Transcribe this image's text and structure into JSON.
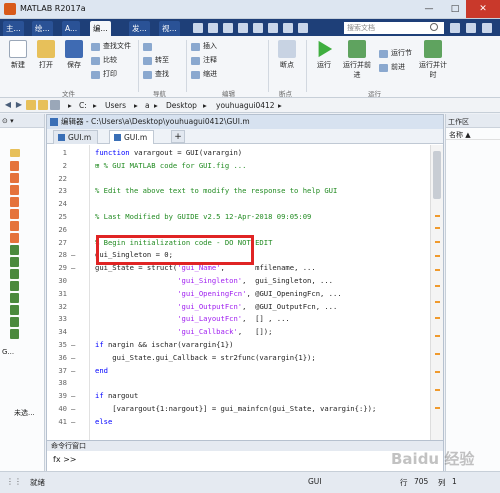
{
  "window": {
    "title": "MATLAB R2017a",
    "controls": [
      "—",
      "□",
      "✕"
    ]
  },
  "main_tabs": [
    "主...",
    "绘...",
    "A...",
    "编...",
    "发...",
    "视..."
  ],
  "search": {
    "placeholder": "搜索文档"
  },
  "ribbon": {
    "new": "新建",
    "open": "打开",
    "save": "保存",
    "find_files": "查找文件",
    "compare": "比较",
    "print": "打印",
    "goto": "转至",
    "find": "查找",
    "insert": "插入",
    "comment": "注释",
    "indent": "缩进",
    "breakpoints": "断点",
    "run": "运行",
    "run_advance": "运行并前进",
    "run_section": "运行节",
    "advance": "前进",
    "run_time": "运行并计时",
    "groups": [
      "文件",
      "导航",
      "编辑",
      "断点",
      "运行"
    ]
  },
  "address": {
    "crumbs": [
      "C:",
      "Users",
      "a",
      "Desktop",
      "youhuagui0412"
    ]
  },
  "left_panel": {
    "bottom_label": "未选...",
    "details_label": "G..."
  },
  "editor": {
    "title": "编辑器 - C:\\Users\\a\\Desktop\\youhuagui0412\\GUI.m",
    "tabs": [
      "GUI.m",
      "GUI.m"
    ],
    "add_tab": "+",
    "lines": [
      {
        "n": "1",
        "mark": "",
        "html": "<span class=\"kw\">function</span> varargout = GUI(varargin)"
      },
      {
        "n": "2",
        "mark": "",
        "html": "<span class=\"cm\">⊞ % GUI MATLAB code for GUI.fig ...</span>"
      },
      {
        "n": "22",
        "mark": "",
        "html": ""
      },
      {
        "n": "23",
        "mark": "",
        "html": "<span class=\"cm\">% Edit the above text to modify the response to help GUI</span>"
      },
      {
        "n": "24",
        "mark": "",
        "html": ""
      },
      {
        "n": "25",
        "mark": "",
        "html": "<span class=\"cm\">% Last Modified by GUIDE v2.5 12-Apr-2018 09:05:09</span>"
      },
      {
        "n": "26",
        "mark": "",
        "html": ""
      },
      {
        "n": "27",
        "mark": "",
        "html": "<span class=\"cm\">% Begin initialization code - DO NOT EDIT</span>"
      },
      {
        "n": "28",
        "mark": "–",
        "html": "gui_Singleton = 0;"
      },
      {
        "n": "29",
        "mark": "–",
        "html": "gui_State = struct(<span class=\"st\">'gui_Name'</span>,       mfilename, ..."
      },
      {
        "n": "30",
        "mark": "",
        "html": "                   <span class=\"st\">'gui_Singleton'</span>,  gui_Singleton, ..."
      },
      {
        "n": "31",
        "mark": "",
        "html": "                   <span class=\"st\">'gui_OpeningFcn'</span>, @GUI_OpeningFcn, ..."
      },
      {
        "n": "32",
        "mark": "",
        "html": "                   <span class=\"st\">'gui_OutputFcn'</span>,  @GUI_OutputFcn, ..."
      },
      {
        "n": "33",
        "mark": "",
        "html": "                   <span class=\"st\">'gui_LayoutFcn'</span>,  [] , ..."
      },
      {
        "n": "34",
        "mark": "",
        "html": "                   <span class=\"st\">'gui_Callback'</span>,   []);"
      },
      {
        "n": "35",
        "mark": "–",
        "html": "<span class=\"kw\">if</span> nargin &amp;&amp; ischar(varargin{1})"
      },
      {
        "n": "36",
        "mark": "–",
        "html": "    gui_State.gui_Callback = str2func(varargin{1});"
      },
      {
        "n": "37",
        "mark": "–",
        "html": "<span class=\"kw\">end</span>"
      },
      {
        "n": "38",
        "mark": "",
        "html": ""
      },
      {
        "n": "39",
        "mark": "–",
        "html": "<span class=\"kw\">if</span> nargout"
      },
      {
        "n": "40",
        "mark": "–",
        "html": "    [varargout{1:nargout}] = gui_mainfcn(gui_State, varargin{:});"
      },
      {
        "n": "41",
        "mark": "–",
        "html": "<span class=\"kw\">else</span>"
      }
    ]
  },
  "command_window": {
    "title": "命令行窗口",
    "prompt": "fx >>"
  },
  "right_panel": {
    "title": "工作区",
    "column": "名称 ▲"
  },
  "status": {
    "left": "就绪",
    "script": "GUI",
    "row_label": "行",
    "row": "705",
    "col_label": "列",
    "col": "1"
  },
  "watermark": "Baidu 经验"
}
